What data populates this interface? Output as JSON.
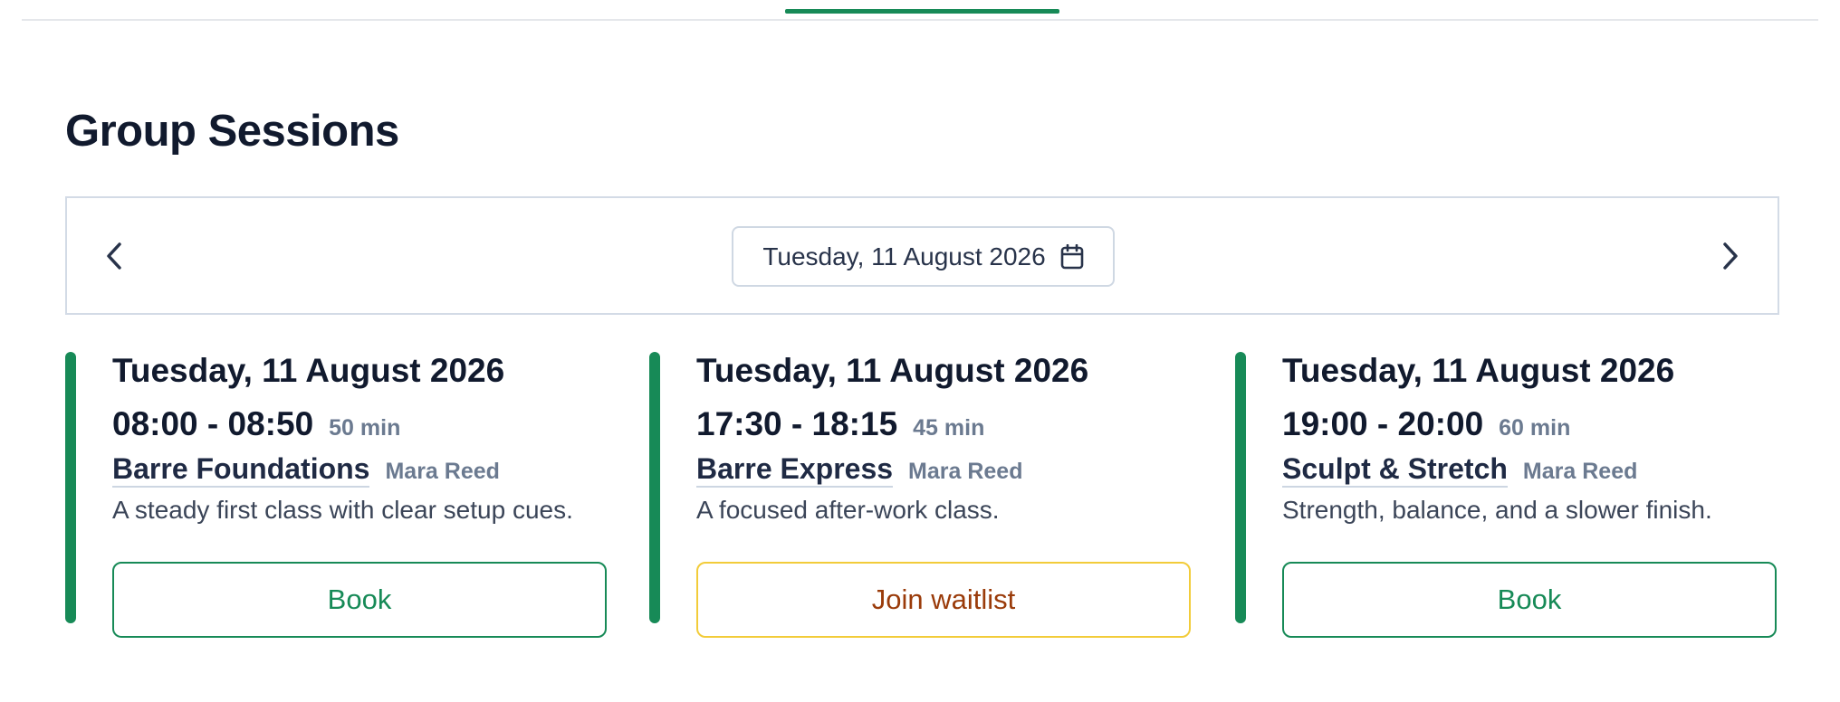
{
  "page": {
    "title": "Group Sessions"
  },
  "date_nav": {
    "selected_date": "Tuesday, 11 August 2026",
    "prev_icon": "chevron-left-icon",
    "next_icon": "chevron-right-icon",
    "calendar_icon": "calendar-icon"
  },
  "colors": {
    "accent": "#178a57",
    "waitlist_border": "#f2cc3a",
    "waitlist_text": "#9a3b0a",
    "title": "#111a2e",
    "muted": "#6b7a90"
  },
  "sessions": [
    {
      "date": "Tuesday, 11 August 2026",
      "time": "08:00 - 08:50",
      "duration": "50 min",
      "name": "Barre Foundations",
      "instructor": "Mara Reed",
      "description": "A steady first class with clear setup cues.",
      "action": "Book"
    },
    {
      "date": "Tuesday, 11 August 2026",
      "time": "17:30 - 18:15",
      "duration": "45 min",
      "name": "Barre Express",
      "instructor": "Mara Reed",
      "description": "A focused after-work class.",
      "action": "Join waitlist"
    },
    {
      "date": "Tuesday, 11 August 2026",
      "time": "19:00 - 20:00",
      "duration": "60 min",
      "name": "Sculpt & Stretch",
      "instructor": "Mara Reed",
      "description": "Strength, balance, and a slower finish.",
      "action": "Book"
    }
  ]
}
